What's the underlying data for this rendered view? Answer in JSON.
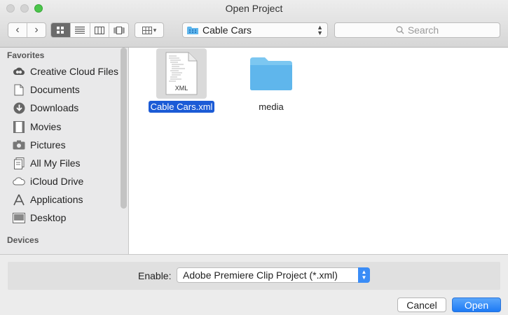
{
  "window": {
    "title": "Open Project"
  },
  "toolbar": {
    "location": "Cable Cars",
    "search_placeholder": "Search"
  },
  "sidebar": {
    "favorites_heading": "Favorites",
    "items": [
      {
        "label": "Creative Cloud Files",
        "icon": "creative-cloud-icon"
      },
      {
        "label": "Documents",
        "icon": "documents-icon"
      },
      {
        "label": "Downloads",
        "icon": "downloads-icon"
      },
      {
        "label": "Movies",
        "icon": "movies-icon"
      },
      {
        "label": "Pictures",
        "icon": "pictures-icon"
      },
      {
        "label": "All My Files",
        "icon": "all-my-files-icon"
      },
      {
        "label": "iCloud Drive",
        "icon": "icloud-icon"
      },
      {
        "label": "Applications",
        "icon": "applications-icon"
      },
      {
        "label": "Desktop",
        "icon": "desktop-icon"
      }
    ],
    "devices_heading": "Devices"
  },
  "files": [
    {
      "name": "Cable Cars.xml",
      "badge": "XML",
      "selected": true
    },
    {
      "name": "media",
      "selected": false
    }
  ],
  "footer": {
    "enable_label": "Enable:",
    "enable_value": "Adobe Premiere Clip Project (*.xml)",
    "cancel_label": "Cancel",
    "open_label": "Open"
  },
  "colors": {
    "accent": "#1d7af5",
    "selection": "#1b5bd6",
    "folder": "#5fb6ec"
  }
}
